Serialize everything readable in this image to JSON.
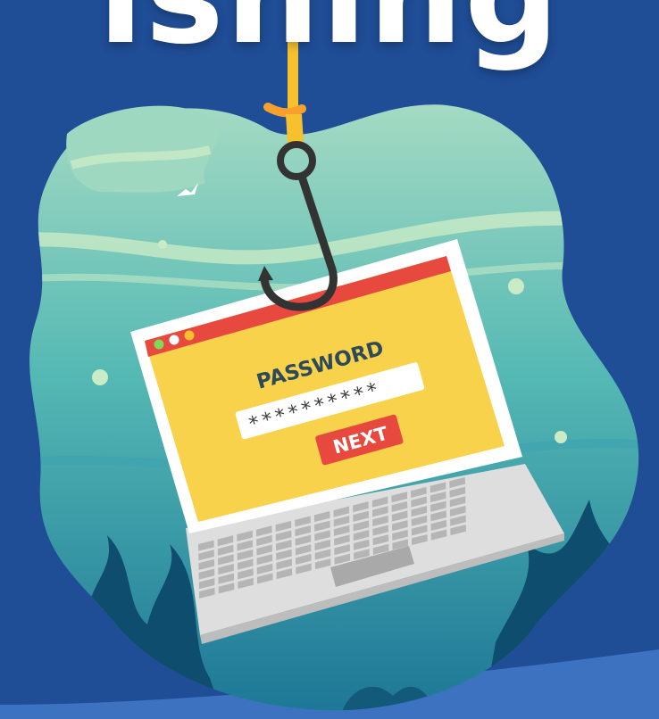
{
  "headline": "ishing",
  "login_window": {
    "password_label": "PASSWORD",
    "password_value": "**********",
    "next_button": "NEXT"
  },
  "colors": {
    "background": "#1f4d96",
    "water_top": "#a9dcc4",
    "water_bottom": "#1f7f9a",
    "screen": "#f8d24a",
    "title_bar": "#e8493f",
    "hook_line": "#f7c12d",
    "next_button": "#e8493f"
  },
  "icons": [
    "fishing-hook-icon",
    "window-dots-icon",
    "bird-icon"
  ]
}
